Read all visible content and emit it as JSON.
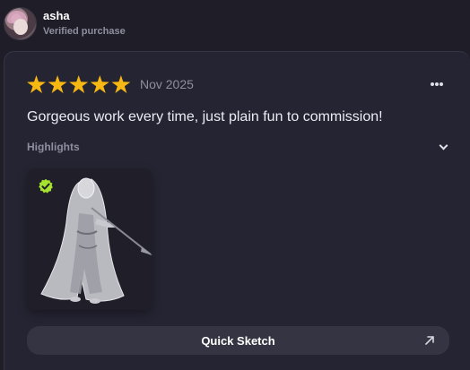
{
  "reviewer": {
    "name": "asha",
    "badge": "Verified purchase",
    "avatar_icon": "avatar-portrait"
  },
  "review": {
    "rating": 5,
    "rating_max": 5,
    "star_color": "#f7b813",
    "date": "Nov 2025",
    "text": "Gorgeous work every time, just plain fun to commission!",
    "more_icon": "more-horizontal-icon",
    "highlights_label": "Highlights",
    "highlights_icon": "chevron-down-icon",
    "image": {
      "description_icon": "artwork-thumbnail",
      "badge_icon": "verified-check-icon",
      "badge_color": "#a6e22e"
    },
    "action": {
      "label": "Quick Sketch",
      "icon": "arrow-up-right-icon"
    }
  },
  "colors": {
    "background": "#1e1d28",
    "card": "#252432",
    "muted_text": "#8f8e9e",
    "button": "#353442"
  }
}
